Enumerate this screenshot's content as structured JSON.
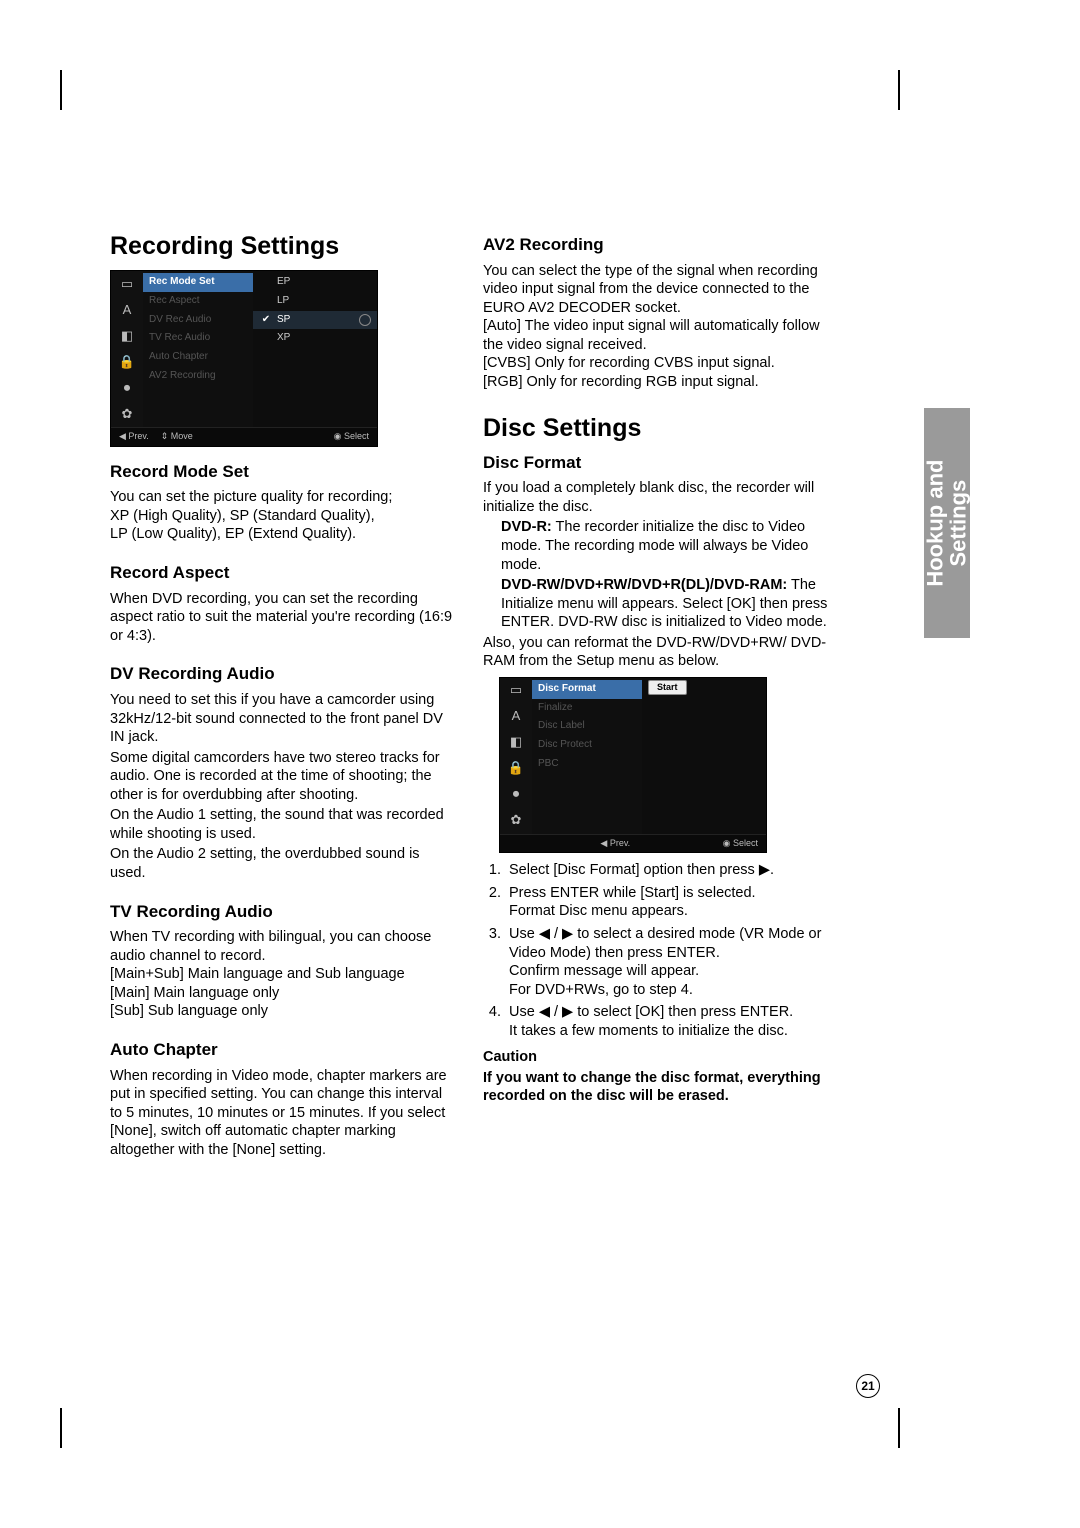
{
  "sideTab": {
    "line1": "Hookup and",
    "line2": "Settings"
  },
  "pageNumber": "21",
  "h1_recording": "Recording Settings",
  "h1_disc": "Disc Settings",
  "osd1": {
    "menu": [
      "Rec Mode Set",
      "Rec Aspect",
      "DV Rec Audio",
      "TV Rec Audio",
      "Auto Chapter",
      "AV2 Recording"
    ],
    "opts": [
      "EP",
      "LP",
      "SP",
      "XP"
    ],
    "selected": "SP",
    "foot_prev": "◀ Prev.",
    "foot_move": "⇕ Move",
    "foot_select": "◉ Select"
  },
  "osd2": {
    "menu": [
      "Disc Format",
      "Finalize",
      "Disc Label",
      "Disc Protect",
      "PBC"
    ],
    "start": "Start",
    "foot_prev": "◀ Prev.",
    "foot_select": "◉ Select"
  },
  "rec_mode_h": "Record Mode Set",
  "rec_mode_p1": "You can set the picture quality for recording;",
  "rec_mode_p2": "XP (High Quality), SP (Standard Quality),",
  "rec_mode_p3": "LP (Low Quality), EP (Extend Quality).",
  "rec_aspect_h": "Record Aspect",
  "rec_aspect_p": "When DVD recording, you can set the recording aspect ratio to suit the material you're recording (16:9 or 4:3).",
  "dv_h": "DV Recording Audio",
  "dv_p1": "You need to set this if you have a camcorder using 32kHz/12-bit sound connected to the front panel DV IN jack.",
  "dv_p2": "Some digital camcorders have two stereo tracks for audio. One is recorded at the time of shooting; the other is for overdubbing after shooting.",
  "dv_p3": "On the Audio 1 setting, the sound that was recorded while shooting is used.",
  "dv_p4": "On the Audio 2 setting, the overdubbed sound is used.",
  "tv_h": "TV Recording Audio",
  "tv_p1": "When TV recording with bilingual, you can choose audio channel to record.",
  "tv_p2": "[Main+Sub] Main language and Sub language",
  "tv_p3": "[Main] Main language only",
  "tv_p4": "[Sub] Sub language only",
  "auto_h": "Auto Chapter",
  "auto_p": "When recording in Video mode, chapter markers are put in specified setting. You can change this interval to 5 minutes, 10 minutes or 15 minutes. If you select [None], switch off automatic chapter marking altogether with the [None] setting.",
  "av2_h": "AV2 Recording",
  "av2_p1": "You can select the type of the signal when recording video input signal from the device connected to the EURO AV2 DECODER socket.",
  "av2_p2": "[Auto] The video input signal will automatically follow the video signal received.",
  "av2_p3": "[CVBS] Only for recording CVBS input signal.",
  "av2_p4": "[RGB] Only for recording RGB input signal.",
  "df_h": "Disc Format",
  "df_p1": "If you load a completely blank disc, the recorder will initialize the disc.",
  "df_dvdr_b": "DVD-R:",
  "df_dvdr_t": " The recorder initialize the disc to Video mode. The recording mode will always be Video mode.",
  "df_rw_b": "DVD-RW/DVD+RW/DVD+R(DL)/DVD-RAM:",
  "df_rw_t": " The Initialize menu will appears. Select [OK] then press ENTER. DVD-RW disc is initialized to Video mode.",
  "df_p2": "Also, you can reformat the DVD-RW/DVD+RW/ DVD-RAM from the Setup menu as below.",
  "steps": {
    "s1": "Select [Disc Format] option then press ▶.",
    "s2a": "Press ENTER while [Start] is selected.",
    "s2b": "Format Disc menu appears.",
    "s3a": "Use ◀ / ▶ to select a desired mode (VR Mode or Video Mode) then press ENTER.",
    "s3b": "Confirm message will appear.",
    "s3c": "For DVD+RWs, go to step 4.",
    "s4a": "Use ◀ / ▶ to select [OK] then press ENTER.",
    "s4b": "It takes a few moments to initialize the disc."
  },
  "caution_h": "Caution",
  "caution_b": "If you want to change the disc format, everything recorded on the disc will be erased."
}
